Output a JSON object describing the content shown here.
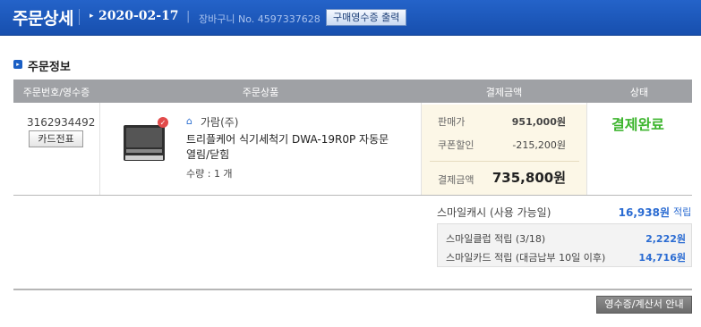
{
  "header": {
    "title": "주문상세",
    "date": "2020-02-17",
    "cart_text": "장바구니 No. 4597337628",
    "receipt_print_button": "구매영수증 출력"
  },
  "section": {
    "title": "주문정보"
  },
  "table": {
    "columns": [
      "주문번호/영수증",
      "주문상품",
      "결제금액",
      "상태"
    ]
  },
  "order": {
    "order_number": "3162934492",
    "card_slip_button": "카드전표",
    "seller": "가람(주)",
    "product_name": "트리플케어 식기세척기 DWA-19R0P 자동문 열림/닫힘",
    "quantity": "수량 : 1 개",
    "payment": {
      "sale_price_label": "판매가",
      "sale_price": "951,000원",
      "coupon_label": "쿠폰할인",
      "coupon": "-215,200원",
      "total_label": "결제금액",
      "total": "735,800원"
    },
    "status": "결제완료"
  },
  "smile": {
    "cash_label": "스마일캐시 (사용 가능일)",
    "cash_value": "16,938원",
    "cash_tail": "적립",
    "club_label": "스마일클럽 적립 (3/18)",
    "club_value": "2,222원",
    "card_label": "스마일카드 적립 (대금납부 10일 이후)",
    "card_value": "14,716원"
  },
  "footer": {
    "receipt_guide_button": "영수증/계산서 안내"
  },
  "colors": {
    "header_blue": "#1a55b8",
    "status_green": "#3db52e",
    "link_blue": "#2a6bd2"
  }
}
